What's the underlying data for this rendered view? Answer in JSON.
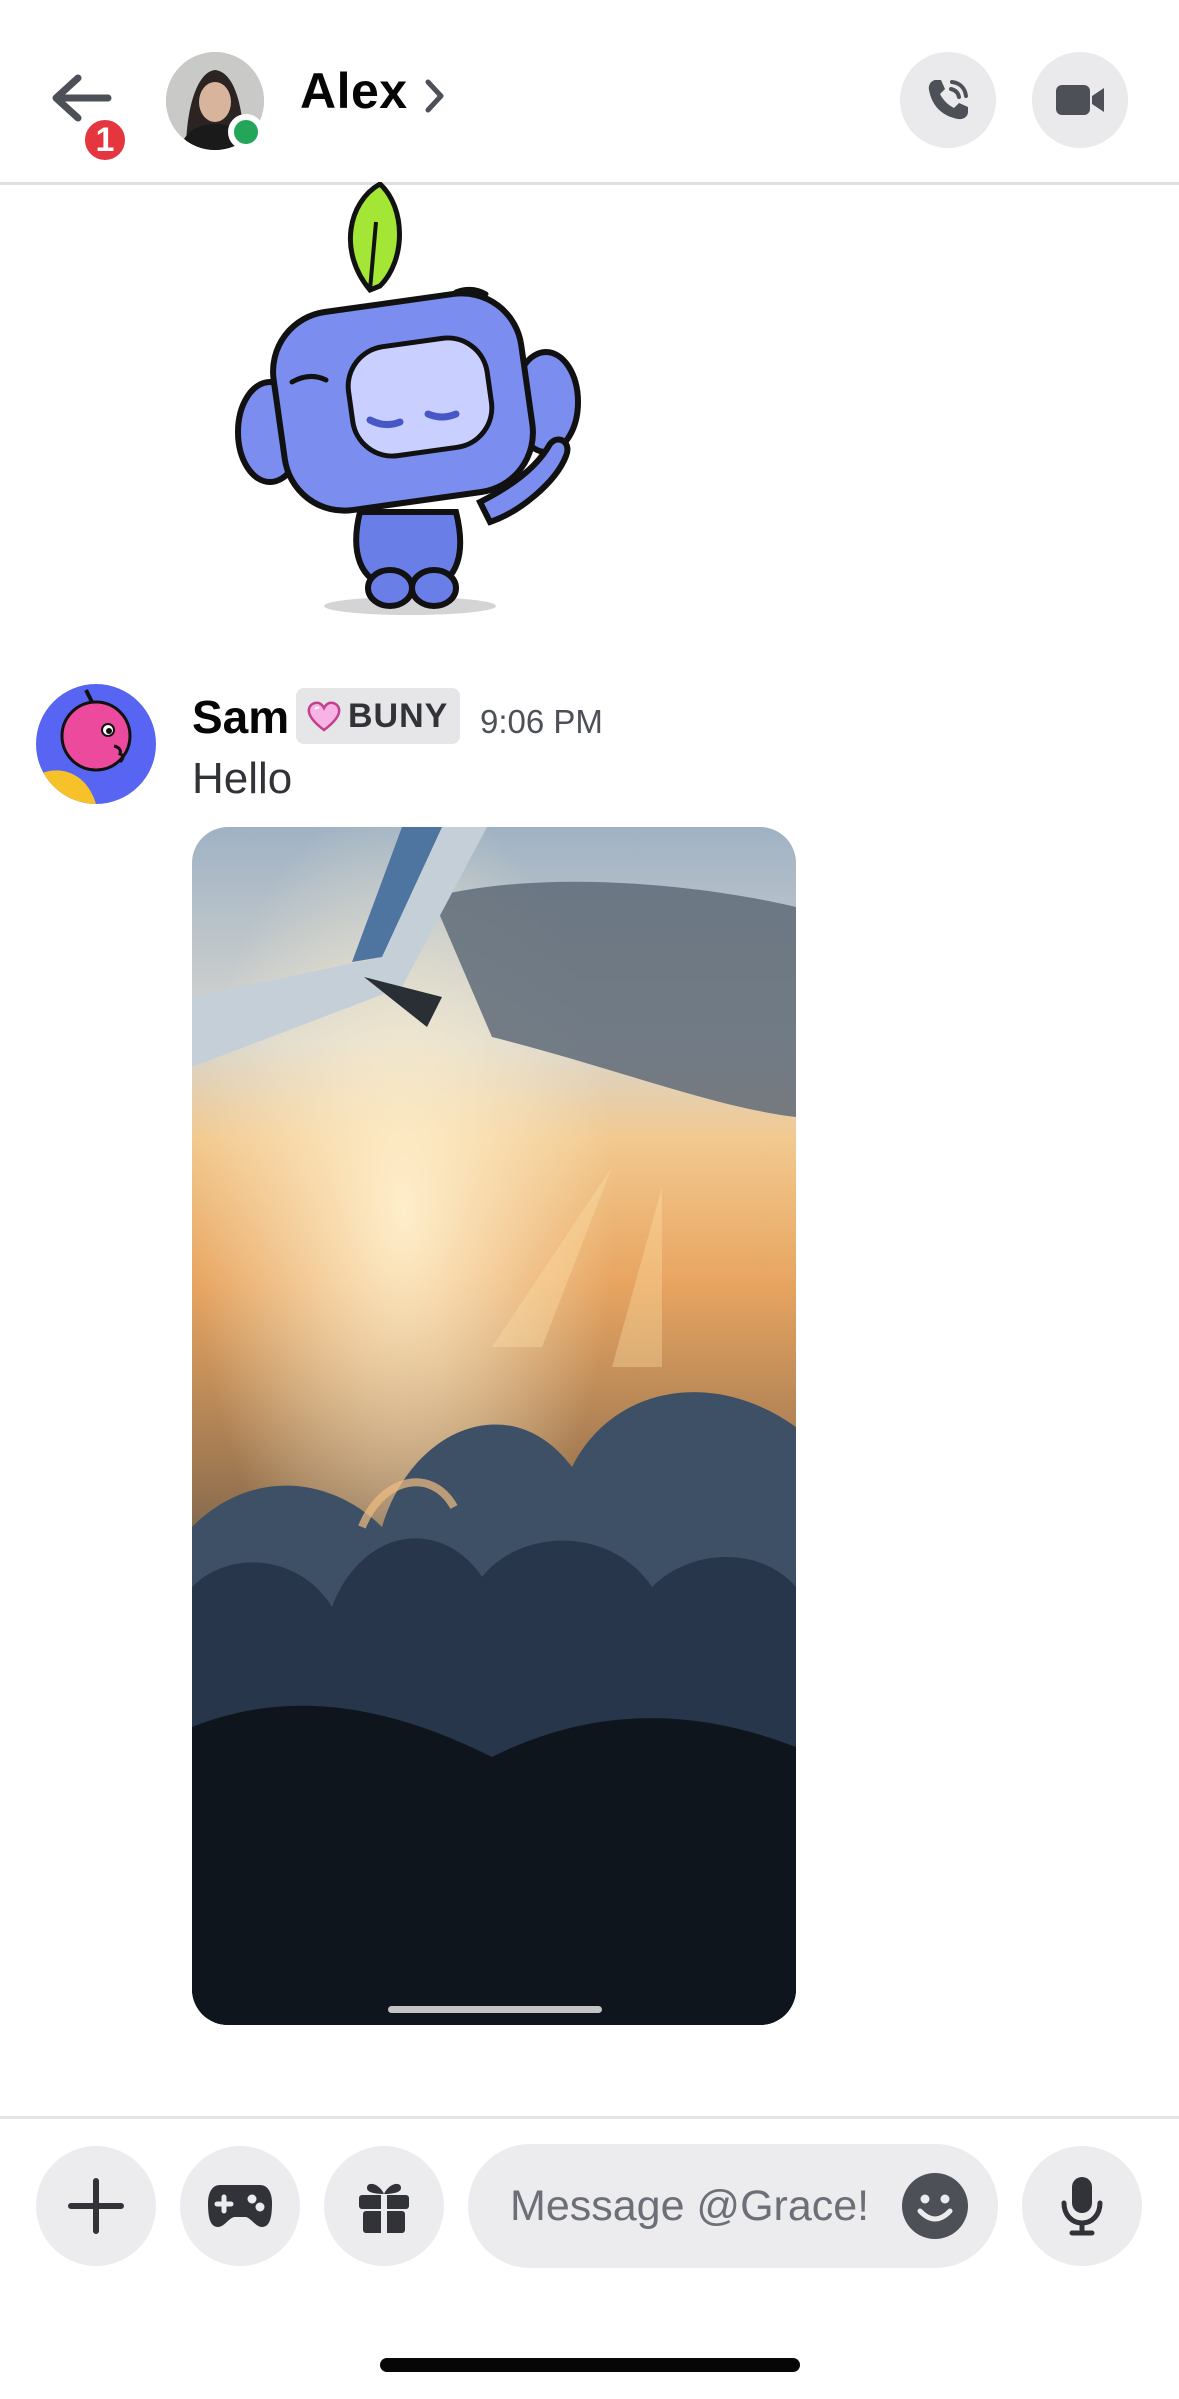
{
  "header": {
    "back_badge": "1",
    "contact_name": "Alex",
    "status": "online",
    "icons": [
      "back-arrow-icon",
      "chevron-right-icon",
      "phone-call-icon",
      "video-camera-icon"
    ]
  },
  "sticker": {
    "icon": "wumpus-waving-sticker"
  },
  "message": {
    "author": "Sam",
    "tag_icon": "heart-icon",
    "tag": "BUNY",
    "timestamp": "9:06 PM",
    "text": "Hello",
    "attachment_icon": "airplane-wing-sunset-photo"
  },
  "composer": {
    "placeholder": "Message @Grace!",
    "icons": [
      "plus-icon",
      "gamepad-icon",
      "gift-icon",
      "emoji-icon",
      "microphone-icon"
    ]
  },
  "colors": {
    "status_online": "#23a55a",
    "badge_red": "#e5353f",
    "tag_bg": "#e6e6e8",
    "button_bg": "#ececee"
  }
}
